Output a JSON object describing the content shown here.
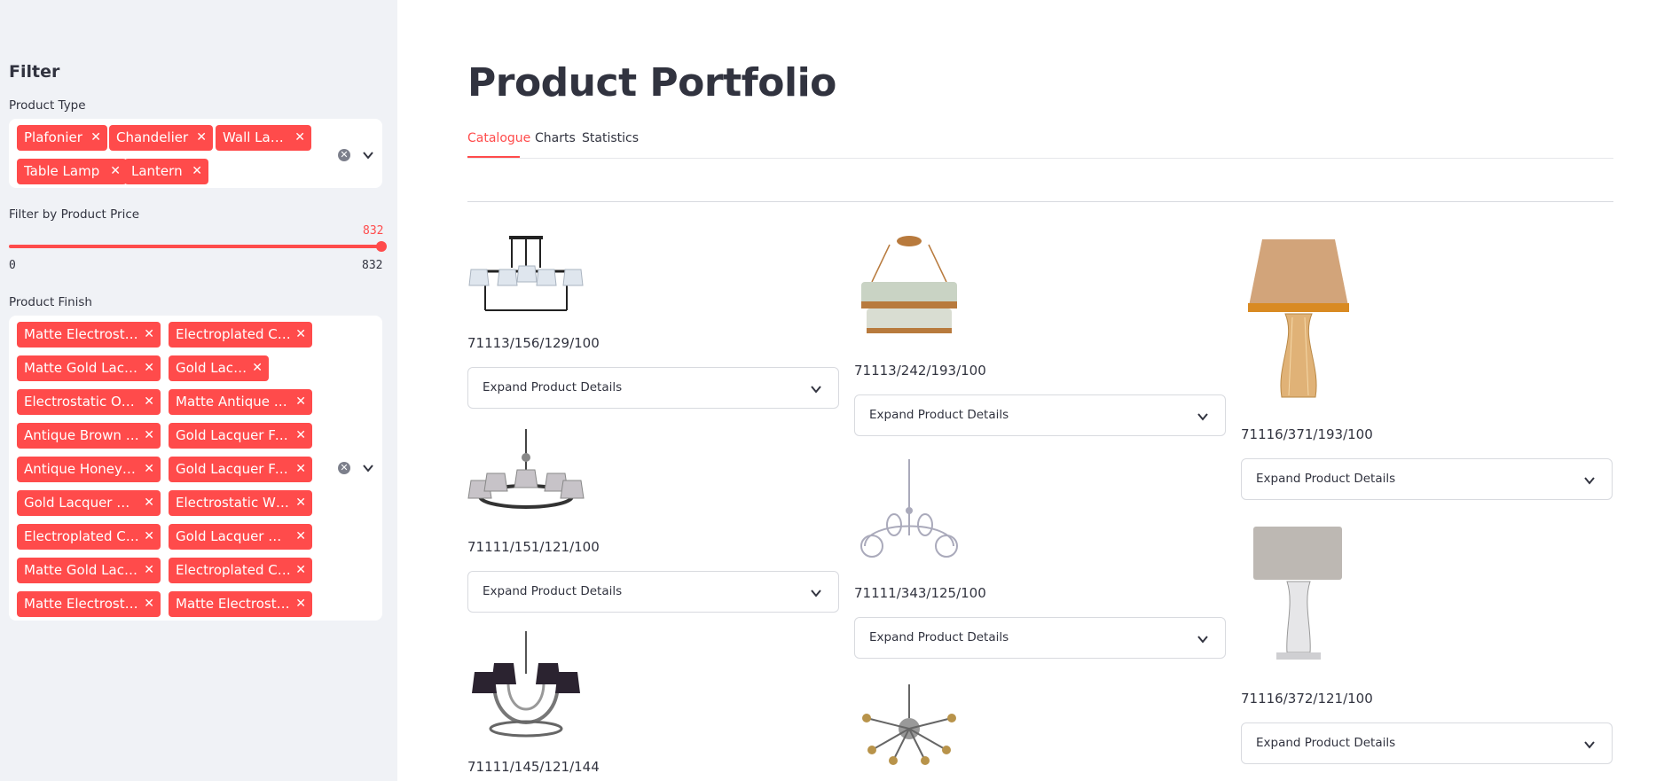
{
  "sidebar": {
    "title": "Filter",
    "product_type": {
      "label": "Product Type",
      "chips": [
        "Plafonier",
        "Chandelier",
        "Wall Lamp",
        "Table Lamp",
        "Lantern"
      ]
    },
    "price": {
      "label": "Filter by Product Price",
      "value": "832",
      "min": "0",
      "max": "832",
      "fraction": 1.0
    },
    "product_finish": {
      "label": "Product Finish",
      "chips": [
        "Matte Electrostat…",
        "Electroplated Ch…",
        "Matte Gold Lacq…",
        "Gold Lacquer",
        "Electrostatic Off-…",
        "Matte Antique Br…",
        "Antique Brown F…",
        "Gold Lacquer Fin…",
        "Antique Honey F…",
        "Gold Lacquer Fin…",
        "Gold Lacquer + …",
        "Electrostatic Whi…",
        "Electroplated Ch…",
        "Gold Lacquer + E…",
        "Matte Gold Lacq…",
        "Electroplated Ch…",
        "Matte Electrostat…",
        "Matte Electrostat…"
      ]
    }
  },
  "main": {
    "title": "Product Portfolio",
    "tabs": [
      {
        "label": "Catalogue",
        "active": true
      },
      {
        "label": "Charts",
        "active": false
      },
      {
        "label": "Statistics",
        "active": false
      }
    ],
    "expander_label": "Expand Product Details",
    "products": [
      {
        "code": "71113/156/129/100"
      },
      {
        "code": "71111/151/121/100"
      },
      {
        "code": "71111/145/121/144"
      },
      {
        "code": "71113/242/193/100"
      },
      {
        "code": "71111/343/125/100"
      },
      {
        "code": "71116/371/193/100"
      },
      {
        "code": "71116/372/121/100"
      }
    ]
  },
  "colors": {
    "accent": "#ff4b4b",
    "sidebar_bg": "#f0f2f6",
    "text": "#31333f"
  }
}
